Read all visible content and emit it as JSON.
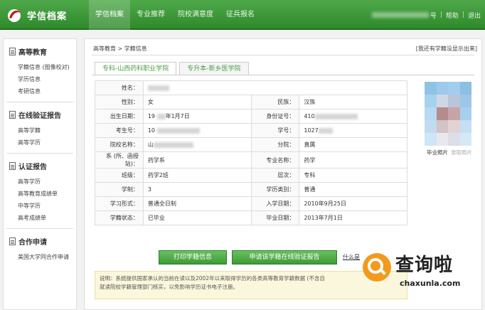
{
  "header": {
    "logo_text": "学信档案",
    "nav": [
      {
        "label": "学信档案",
        "active": true
      },
      {
        "label": "专业推荐",
        "active": false
      },
      {
        "label": "院校满意度",
        "active": false
      },
      {
        "label": "征兵报名",
        "active": false
      }
    ],
    "user_suffix": "号",
    "help": "帮助",
    "logout": "退出"
  },
  "sidebar": {
    "sections": [
      {
        "title": "高等教育",
        "items": [
          "学籍信息 (图像校对)",
          "学历信息",
          "考研信息"
        ]
      },
      {
        "title": "在线验证报告",
        "items": [
          "高等学籍",
          "高等学历"
        ]
      },
      {
        "title": "认证报告",
        "items": [
          "高等学历",
          "高等教育成绩单",
          "中等学历",
          "高考成绩单"
        ]
      },
      {
        "title": "合作申请",
        "items": [
          "美国大学同合作申请"
        ]
      }
    ]
  },
  "main": {
    "breadcrumb": "高等教育 > 学籍信息",
    "show_archive": "[我还有学籍没显示出来]",
    "tabs": [
      {
        "label": "专科-山西药科职业学院",
        "active": true
      },
      {
        "label": "专升本-新乡医学院",
        "active": false
      }
    ],
    "fields": {
      "name_label": "姓名：",
      "gender_label": "性别：",
      "gender": "女",
      "ethnicity_label": "民族：",
      "ethnicity": "汉族",
      "birth_label": "出生日期：",
      "birth_prefix": "19",
      "birth_suffix": "年1月7日",
      "id_label": "身份证号：",
      "id_prefix": "410",
      "exam_label": "考生号：",
      "exam_prefix": "10",
      "student_no_label": "学号：",
      "student_no_prefix": "1027",
      "school_label": "院校名称：",
      "school_prefix": "山",
      "branch_label": "分院：",
      "branch": "直属",
      "dept_label": "系 (所、函授站)：",
      "dept": "药学系",
      "major_label": "专业名称：",
      "major": "药学",
      "class_label": "班级：",
      "class": "药学2班",
      "level_label": "层次：",
      "level": "专科",
      "duration_label": "学制：",
      "duration": "3",
      "category_label": "学历类别：",
      "category": "普通",
      "form_label": "学习形式：",
      "form": "普通全日制",
      "enroll_label": "入学日期：",
      "enroll": "2010年9月25日",
      "status_label": "学籍状态：",
      "status": "已毕业",
      "grad_label": "毕业日期：",
      "grad": "2013年7月1日"
    },
    "photo_caption": "毕业照片",
    "photo_caption_alt": "录取照片",
    "buttons": {
      "print": "打印学籍信息",
      "apply": "申请该学籍在线验证报告",
      "help_link": "什么是"
    },
    "note_line1": "说明：系统提供国家承认的当前在读以及2002年以来取得学历的各类高等教育学籍数据 (不含自",
    "note_line2": "就读院校学籍管理部门核实，以免影响学历证书电子注册。"
  },
  "watermark": {
    "cn": "查询啦",
    "url": "chaxunla.com"
  },
  "colors": {
    "brand_green": "#3f9a38",
    "status_red": "#d9342b"
  }
}
